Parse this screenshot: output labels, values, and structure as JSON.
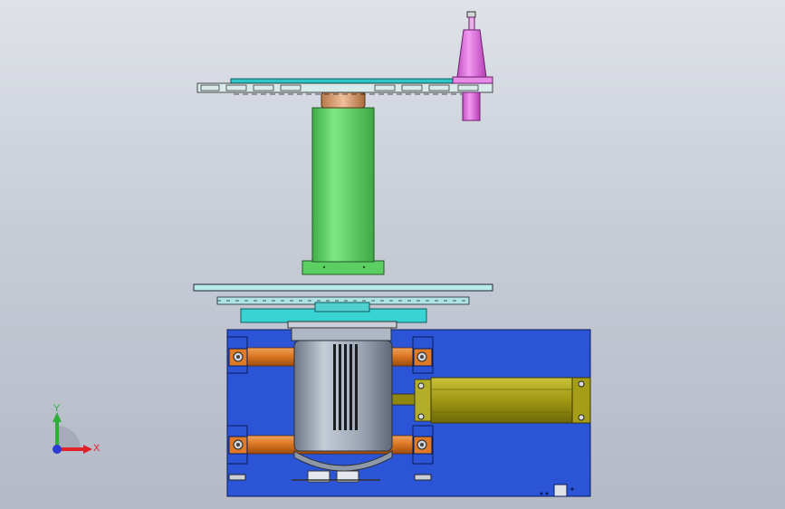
{
  "viewport": {
    "background_top": "#dfe2e8",
    "background_bottom": "#b3b9c6"
  },
  "triad": {
    "x_label": "X",
    "y_label": "Y",
    "x_color": "#e0222a",
    "y_color": "#2fae3a",
    "z_color": "#2b3bd6"
  },
  "colors": {
    "base_plate": "#2b55d6",
    "column": "#63d66a",
    "column_ring": "#5ccf63",
    "bearing_cap": "#d69a6a",
    "tool_holder": "#e67ae6",
    "flange": "#3ad3d3",
    "disc": "#aee4e4",
    "motor": "#9ba6b4",
    "rods": "#e07a26",
    "servo": "#a29a14"
  },
  "icons": [
    "triad-icon"
  ]
}
